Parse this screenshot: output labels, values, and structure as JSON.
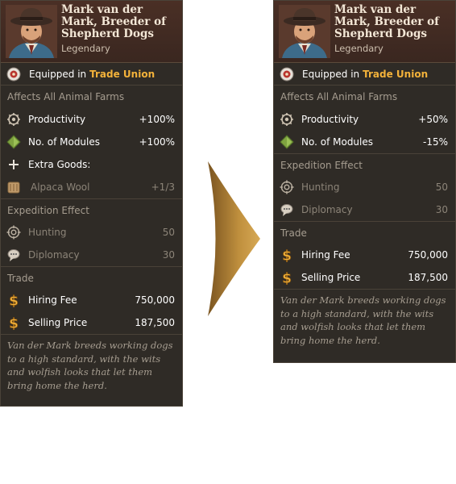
{
  "colors": {
    "panel_bg": "#2f2b26",
    "header_bg": "#4a2f25",
    "accent_gold": "#f3b23a",
    "arrow_gold": "#b88433",
    "text_dim": "#8c8478",
    "section_text": "#a69d90"
  },
  "before": {
    "name": "Mark van der Mark, Breeder of Shepherd Dogs",
    "rarity": "Legendary",
    "equipped_label": "Equipped in",
    "equipped_target": "Trade Union",
    "affects_label": "Affects All Animal Farms",
    "stats": [
      {
        "icon": "productivity-gear-icon",
        "label": "Productivity",
        "value": "+100%"
      },
      {
        "icon": "modules-diamond-icon",
        "label": "No. of Modules",
        "value": "+100%"
      }
    ],
    "extra_goods_label": "Extra Goods:",
    "extra_goods": [
      {
        "icon": "alpaca-wool-icon",
        "label": "Alpaca Wool",
        "value": "+1/3"
      }
    ],
    "expedition_label": "Expedition Effect",
    "expedition": [
      {
        "icon": "hunting-crosshair-icon",
        "label": "Hunting",
        "value": "50"
      },
      {
        "icon": "diplomacy-icon",
        "label": "Diplomacy",
        "value": "30"
      }
    ],
    "trade_label": "Trade",
    "trade": [
      {
        "icon": "dollar-icon",
        "label": "Hiring Fee",
        "value": "750,000"
      },
      {
        "icon": "dollar-icon",
        "label": "Selling Price",
        "value": "187,500"
      }
    ],
    "description": "Van der Mark breeds working dogs to a high standard, with the wits and wolfish looks that let them bring home the herd."
  },
  "after": {
    "name": "Mark van der Mark, Breeder of Shepherd Dogs",
    "rarity": "Legendary",
    "equipped_label": "Equipped in",
    "equipped_target": "Trade Union",
    "affects_label": "Affects All Animal Farms",
    "stats": [
      {
        "icon": "productivity-gear-icon",
        "label": "Productivity",
        "value": "+50%"
      },
      {
        "icon": "modules-diamond-icon",
        "label": "No. of Modules",
        "value": "-15%"
      }
    ],
    "expedition_label": "Expedition Effect",
    "expedition": [
      {
        "icon": "hunting-crosshair-icon",
        "label": "Hunting",
        "value": "50"
      },
      {
        "icon": "diplomacy-icon",
        "label": "Diplomacy",
        "value": "30"
      }
    ],
    "trade_label": "Trade",
    "trade": [
      {
        "icon": "dollar-icon",
        "label": "Hiring Fee",
        "value": "750,000"
      },
      {
        "icon": "dollar-icon",
        "label": "Selling Price",
        "value": "187,500"
      }
    ],
    "description": "Van der Mark breeds working dogs to a high standard, with the wits and wolfish looks that let them bring home the herd."
  }
}
